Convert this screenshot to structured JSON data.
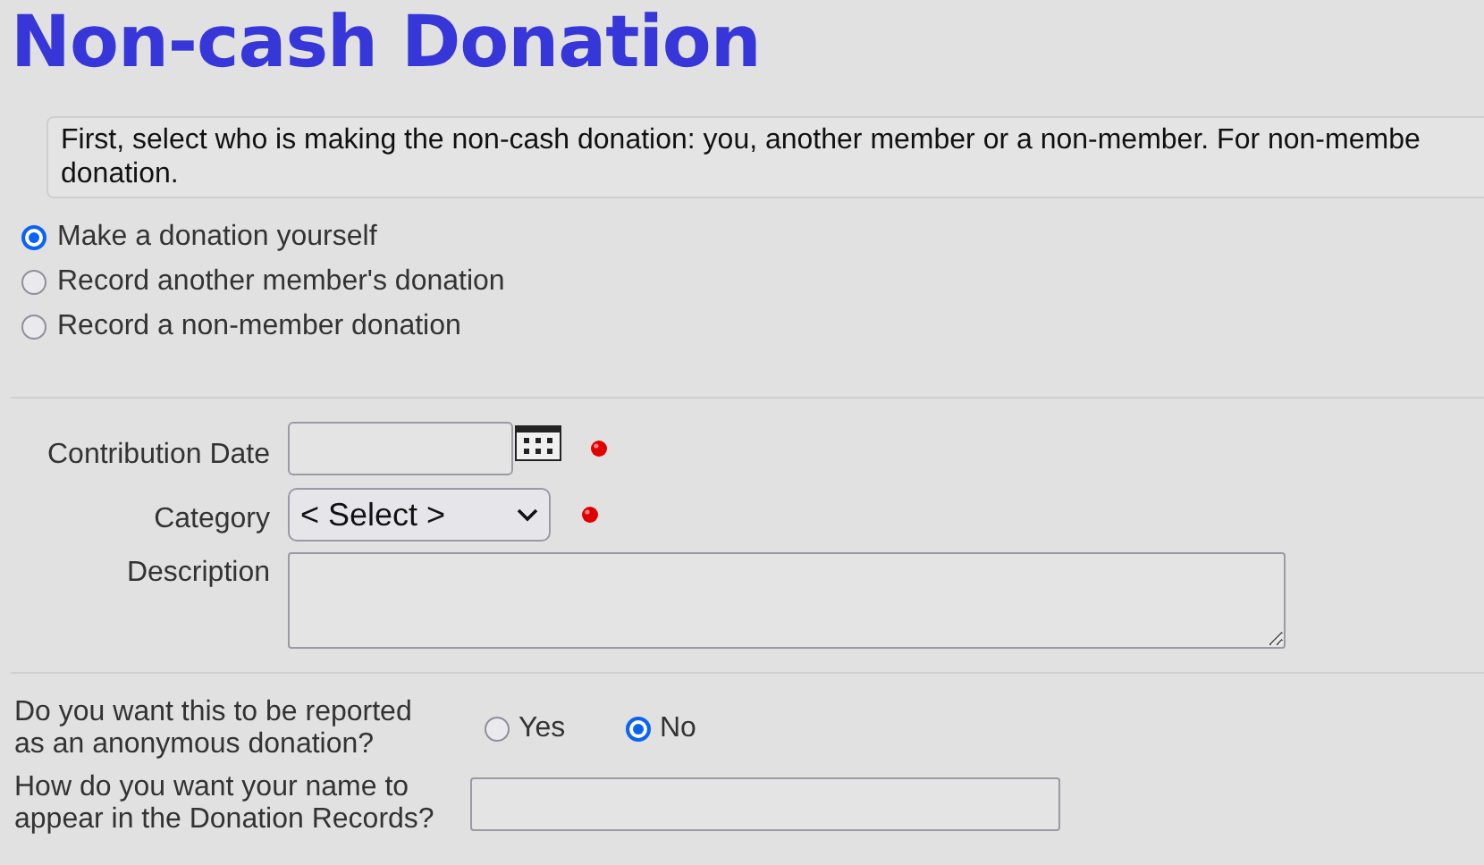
{
  "title": "Non-cash Donation",
  "instructions": [
    "First, select who is making the non-cash donation: you, another member or a non-member. For non-membe",
    "donation."
  ],
  "donor_options": [
    {
      "label": "Make a donation yourself",
      "selected": true
    },
    {
      "label": "Record another member's donation",
      "selected": false
    },
    {
      "label": "Record a non-member donation",
      "selected": false
    }
  ],
  "fields": [
    {
      "kind": "date",
      "label": "Contribution Date",
      "required": true
    },
    {
      "kind": "select",
      "label": "Category",
      "value": "< Select >",
      "required": true
    },
    {
      "kind": "textarea",
      "label": "Description",
      "required": false
    }
  ],
  "anonymous": {
    "question": [
      "Do you want this to be reported",
      "as an anonymous donation?"
    ],
    "options": [
      {
        "label": "Yes",
        "selected": false
      },
      {
        "label": "No",
        "selected": true
      }
    ]
  },
  "name_display": {
    "question": [
      "How do you want your name to",
      "appear in the Donation Records?"
    ]
  }
}
